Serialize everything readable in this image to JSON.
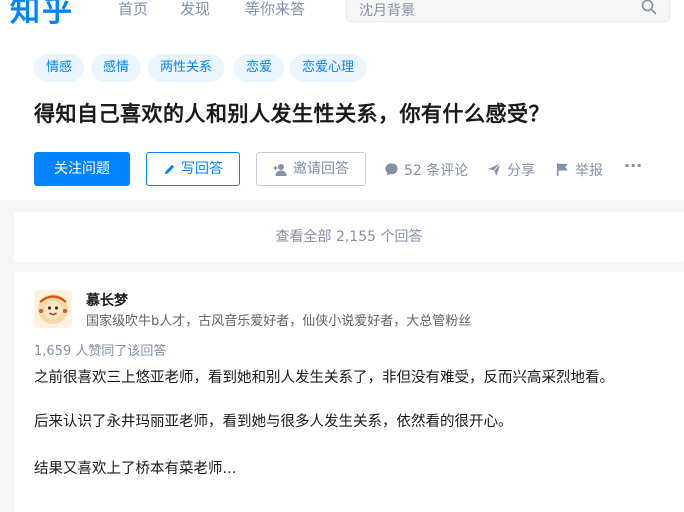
{
  "header": {
    "logo": "知乎",
    "nav": [
      "首页",
      "发现",
      "等你来答"
    ],
    "search_placeholder": "沈月背景"
  },
  "question": {
    "topics": [
      "情感",
      "感情",
      "两性关系",
      "恋爱",
      "恋爱心理"
    ],
    "title": "得知自己喜欢的人和别人发生性关系，你有什么感受？",
    "follow_label": "关注问题",
    "write_label": "写回答",
    "invite_label": "邀请回答",
    "comments_label": "52 条评论",
    "share_label": "分享",
    "report_label": "举报",
    "more_label": "···"
  },
  "view_all": "查看全部 2,155 个回答",
  "answer": {
    "author_name": "慕长梦",
    "author_bio": "国家级吹牛b人才，古风音乐爱好者，仙侠小说爱好者，大总管粉丝",
    "votes": "1,659 人赞同了该回答",
    "paragraphs": [
      "之前很喜欢三上悠亚老师，看到她和别人发生关系了，非但没有难受，反而兴高采烈地看。",
      "后来认识了永井玛丽亚老师，看到她与很多人发生关系，依然看的很开心。",
      "结果又喜欢上了桥本有菜老师..."
    ]
  },
  "colors": {
    "brand": "#0084ff",
    "topic_bg": "#ebf5ff",
    "muted": "#8590a6",
    "page_bg": "#f6f6f6"
  }
}
